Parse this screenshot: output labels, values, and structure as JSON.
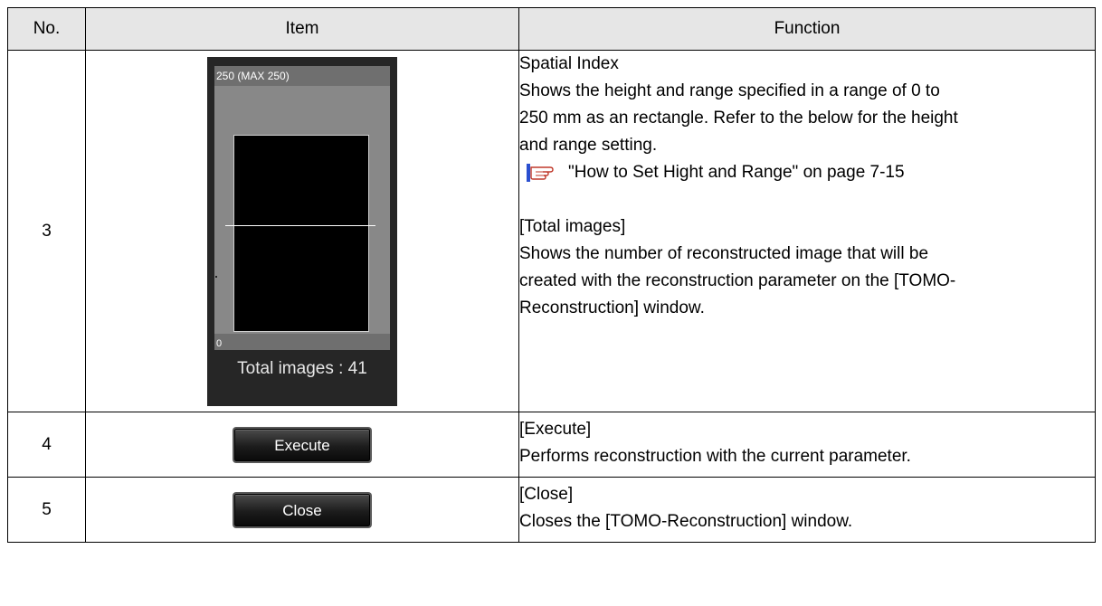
{
  "table": {
    "headers": {
      "no": "No.",
      "item": "Item",
      "function": "Function"
    },
    "rows": [
      {
        "no": "3",
        "panel": {
          "top_label": "250 (MAX 250)",
          "bottom_label": "0",
          "total_images": "Total images : 41"
        },
        "function": {
          "title": "Spatial Index",
          "lines": [
            "Shows the height and range specified in a range of 0 to",
            "250 mm as an rectangle. Refer to the below for the height",
            "and range setting."
          ],
          "reference": "\"How to Set Hight and Range\" on page 7-15",
          "title2": "[Total images]",
          "lines2": [
            "Shows the number of reconstructed image that will be",
            "created with the reconstruction parameter on the [TOMO-",
            "Reconstruction] window."
          ]
        }
      },
      {
        "no": "4",
        "button": "Execute",
        "function": {
          "title": "[Execute]",
          "desc": "Performs reconstruction with the current parameter."
        }
      },
      {
        "no": "5",
        "button": "Close",
        "function": {
          "title": "[Close]",
          "desc": "Closes the [TOMO-Reconstruction] window."
        }
      }
    ]
  },
  "icons": {
    "reference": "pointing-hand-icon"
  }
}
